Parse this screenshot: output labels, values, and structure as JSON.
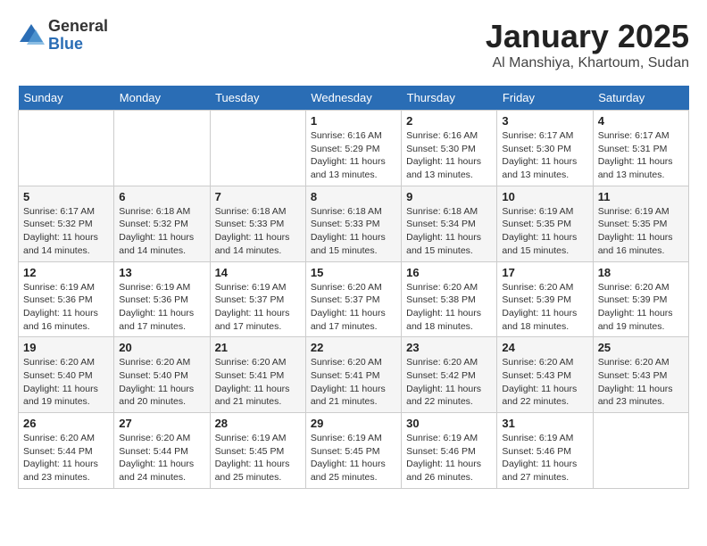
{
  "logo": {
    "general": "General",
    "blue": "Blue"
  },
  "header": {
    "month": "January 2025",
    "location": "Al Manshiya, Khartoum, Sudan"
  },
  "weekdays": [
    "Sunday",
    "Monday",
    "Tuesday",
    "Wednesday",
    "Thursday",
    "Friday",
    "Saturday"
  ],
  "weeks": [
    [
      {
        "day": "",
        "sunrise": "",
        "sunset": "",
        "daylight": ""
      },
      {
        "day": "",
        "sunrise": "",
        "sunset": "",
        "daylight": ""
      },
      {
        "day": "",
        "sunrise": "",
        "sunset": "",
        "daylight": ""
      },
      {
        "day": "1",
        "sunrise": "Sunrise: 6:16 AM",
        "sunset": "Sunset: 5:29 PM",
        "daylight": "Daylight: 11 hours and 13 minutes."
      },
      {
        "day": "2",
        "sunrise": "Sunrise: 6:16 AM",
        "sunset": "Sunset: 5:30 PM",
        "daylight": "Daylight: 11 hours and 13 minutes."
      },
      {
        "day": "3",
        "sunrise": "Sunrise: 6:17 AM",
        "sunset": "Sunset: 5:30 PM",
        "daylight": "Daylight: 11 hours and 13 minutes."
      },
      {
        "day": "4",
        "sunrise": "Sunrise: 6:17 AM",
        "sunset": "Sunset: 5:31 PM",
        "daylight": "Daylight: 11 hours and 13 minutes."
      }
    ],
    [
      {
        "day": "5",
        "sunrise": "Sunrise: 6:17 AM",
        "sunset": "Sunset: 5:32 PM",
        "daylight": "Daylight: 11 hours and 14 minutes."
      },
      {
        "day": "6",
        "sunrise": "Sunrise: 6:18 AM",
        "sunset": "Sunset: 5:32 PM",
        "daylight": "Daylight: 11 hours and 14 minutes."
      },
      {
        "day": "7",
        "sunrise": "Sunrise: 6:18 AM",
        "sunset": "Sunset: 5:33 PM",
        "daylight": "Daylight: 11 hours and 14 minutes."
      },
      {
        "day": "8",
        "sunrise": "Sunrise: 6:18 AM",
        "sunset": "Sunset: 5:33 PM",
        "daylight": "Daylight: 11 hours and 15 minutes."
      },
      {
        "day": "9",
        "sunrise": "Sunrise: 6:18 AM",
        "sunset": "Sunset: 5:34 PM",
        "daylight": "Daylight: 11 hours and 15 minutes."
      },
      {
        "day": "10",
        "sunrise": "Sunrise: 6:19 AM",
        "sunset": "Sunset: 5:35 PM",
        "daylight": "Daylight: 11 hours and 15 minutes."
      },
      {
        "day": "11",
        "sunrise": "Sunrise: 6:19 AM",
        "sunset": "Sunset: 5:35 PM",
        "daylight": "Daylight: 11 hours and 16 minutes."
      }
    ],
    [
      {
        "day": "12",
        "sunrise": "Sunrise: 6:19 AM",
        "sunset": "Sunset: 5:36 PM",
        "daylight": "Daylight: 11 hours and 16 minutes."
      },
      {
        "day": "13",
        "sunrise": "Sunrise: 6:19 AM",
        "sunset": "Sunset: 5:36 PM",
        "daylight": "Daylight: 11 hours and 17 minutes."
      },
      {
        "day": "14",
        "sunrise": "Sunrise: 6:19 AM",
        "sunset": "Sunset: 5:37 PM",
        "daylight": "Daylight: 11 hours and 17 minutes."
      },
      {
        "day": "15",
        "sunrise": "Sunrise: 6:20 AM",
        "sunset": "Sunset: 5:37 PM",
        "daylight": "Daylight: 11 hours and 17 minutes."
      },
      {
        "day": "16",
        "sunrise": "Sunrise: 6:20 AM",
        "sunset": "Sunset: 5:38 PM",
        "daylight": "Daylight: 11 hours and 18 minutes."
      },
      {
        "day": "17",
        "sunrise": "Sunrise: 6:20 AM",
        "sunset": "Sunset: 5:39 PM",
        "daylight": "Daylight: 11 hours and 18 minutes."
      },
      {
        "day": "18",
        "sunrise": "Sunrise: 6:20 AM",
        "sunset": "Sunset: 5:39 PM",
        "daylight": "Daylight: 11 hours and 19 minutes."
      }
    ],
    [
      {
        "day": "19",
        "sunrise": "Sunrise: 6:20 AM",
        "sunset": "Sunset: 5:40 PM",
        "daylight": "Daylight: 11 hours and 19 minutes."
      },
      {
        "day": "20",
        "sunrise": "Sunrise: 6:20 AM",
        "sunset": "Sunset: 5:40 PM",
        "daylight": "Daylight: 11 hours and 20 minutes."
      },
      {
        "day": "21",
        "sunrise": "Sunrise: 6:20 AM",
        "sunset": "Sunset: 5:41 PM",
        "daylight": "Daylight: 11 hours and 21 minutes."
      },
      {
        "day": "22",
        "sunrise": "Sunrise: 6:20 AM",
        "sunset": "Sunset: 5:41 PM",
        "daylight": "Daylight: 11 hours and 21 minutes."
      },
      {
        "day": "23",
        "sunrise": "Sunrise: 6:20 AM",
        "sunset": "Sunset: 5:42 PM",
        "daylight": "Daylight: 11 hours and 22 minutes."
      },
      {
        "day": "24",
        "sunrise": "Sunrise: 6:20 AM",
        "sunset": "Sunset: 5:43 PM",
        "daylight": "Daylight: 11 hours and 22 minutes."
      },
      {
        "day": "25",
        "sunrise": "Sunrise: 6:20 AM",
        "sunset": "Sunset: 5:43 PM",
        "daylight": "Daylight: 11 hours and 23 minutes."
      }
    ],
    [
      {
        "day": "26",
        "sunrise": "Sunrise: 6:20 AM",
        "sunset": "Sunset: 5:44 PM",
        "daylight": "Daylight: 11 hours and 23 minutes."
      },
      {
        "day": "27",
        "sunrise": "Sunrise: 6:20 AM",
        "sunset": "Sunset: 5:44 PM",
        "daylight": "Daylight: 11 hours and 24 minutes."
      },
      {
        "day": "28",
        "sunrise": "Sunrise: 6:19 AM",
        "sunset": "Sunset: 5:45 PM",
        "daylight": "Daylight: 11 hours and 25 minutes."
      },
      {
        "day": "29",
        "sunrise": "Sunrise: 6:19 AM",
        "sunset": "Sunset: 5:45 PM",
        "daylight": "Daylight: 11 hours and 25 minutes."
      },
      {
        "day": "30",
        "sunrise": "Sunrise: 6:19 AM",
        "sunset": "Sunset: 5:46 PM",
        "daylight": "Daylight: 11 hours and 26 minutes."
      },
      {
        "day": "31",
        "sunrise": "Sunrise: 6:19 AM",
        "sunset": "Sunset: 5:46 PM",
        "daylight": "Daylight: 11 hours and 27 minutes."
      },
      {
        "day": "",
        "sunrise": "",
        "sunset": "",
        "daylight": ""
      }
    ]
  ]
}
